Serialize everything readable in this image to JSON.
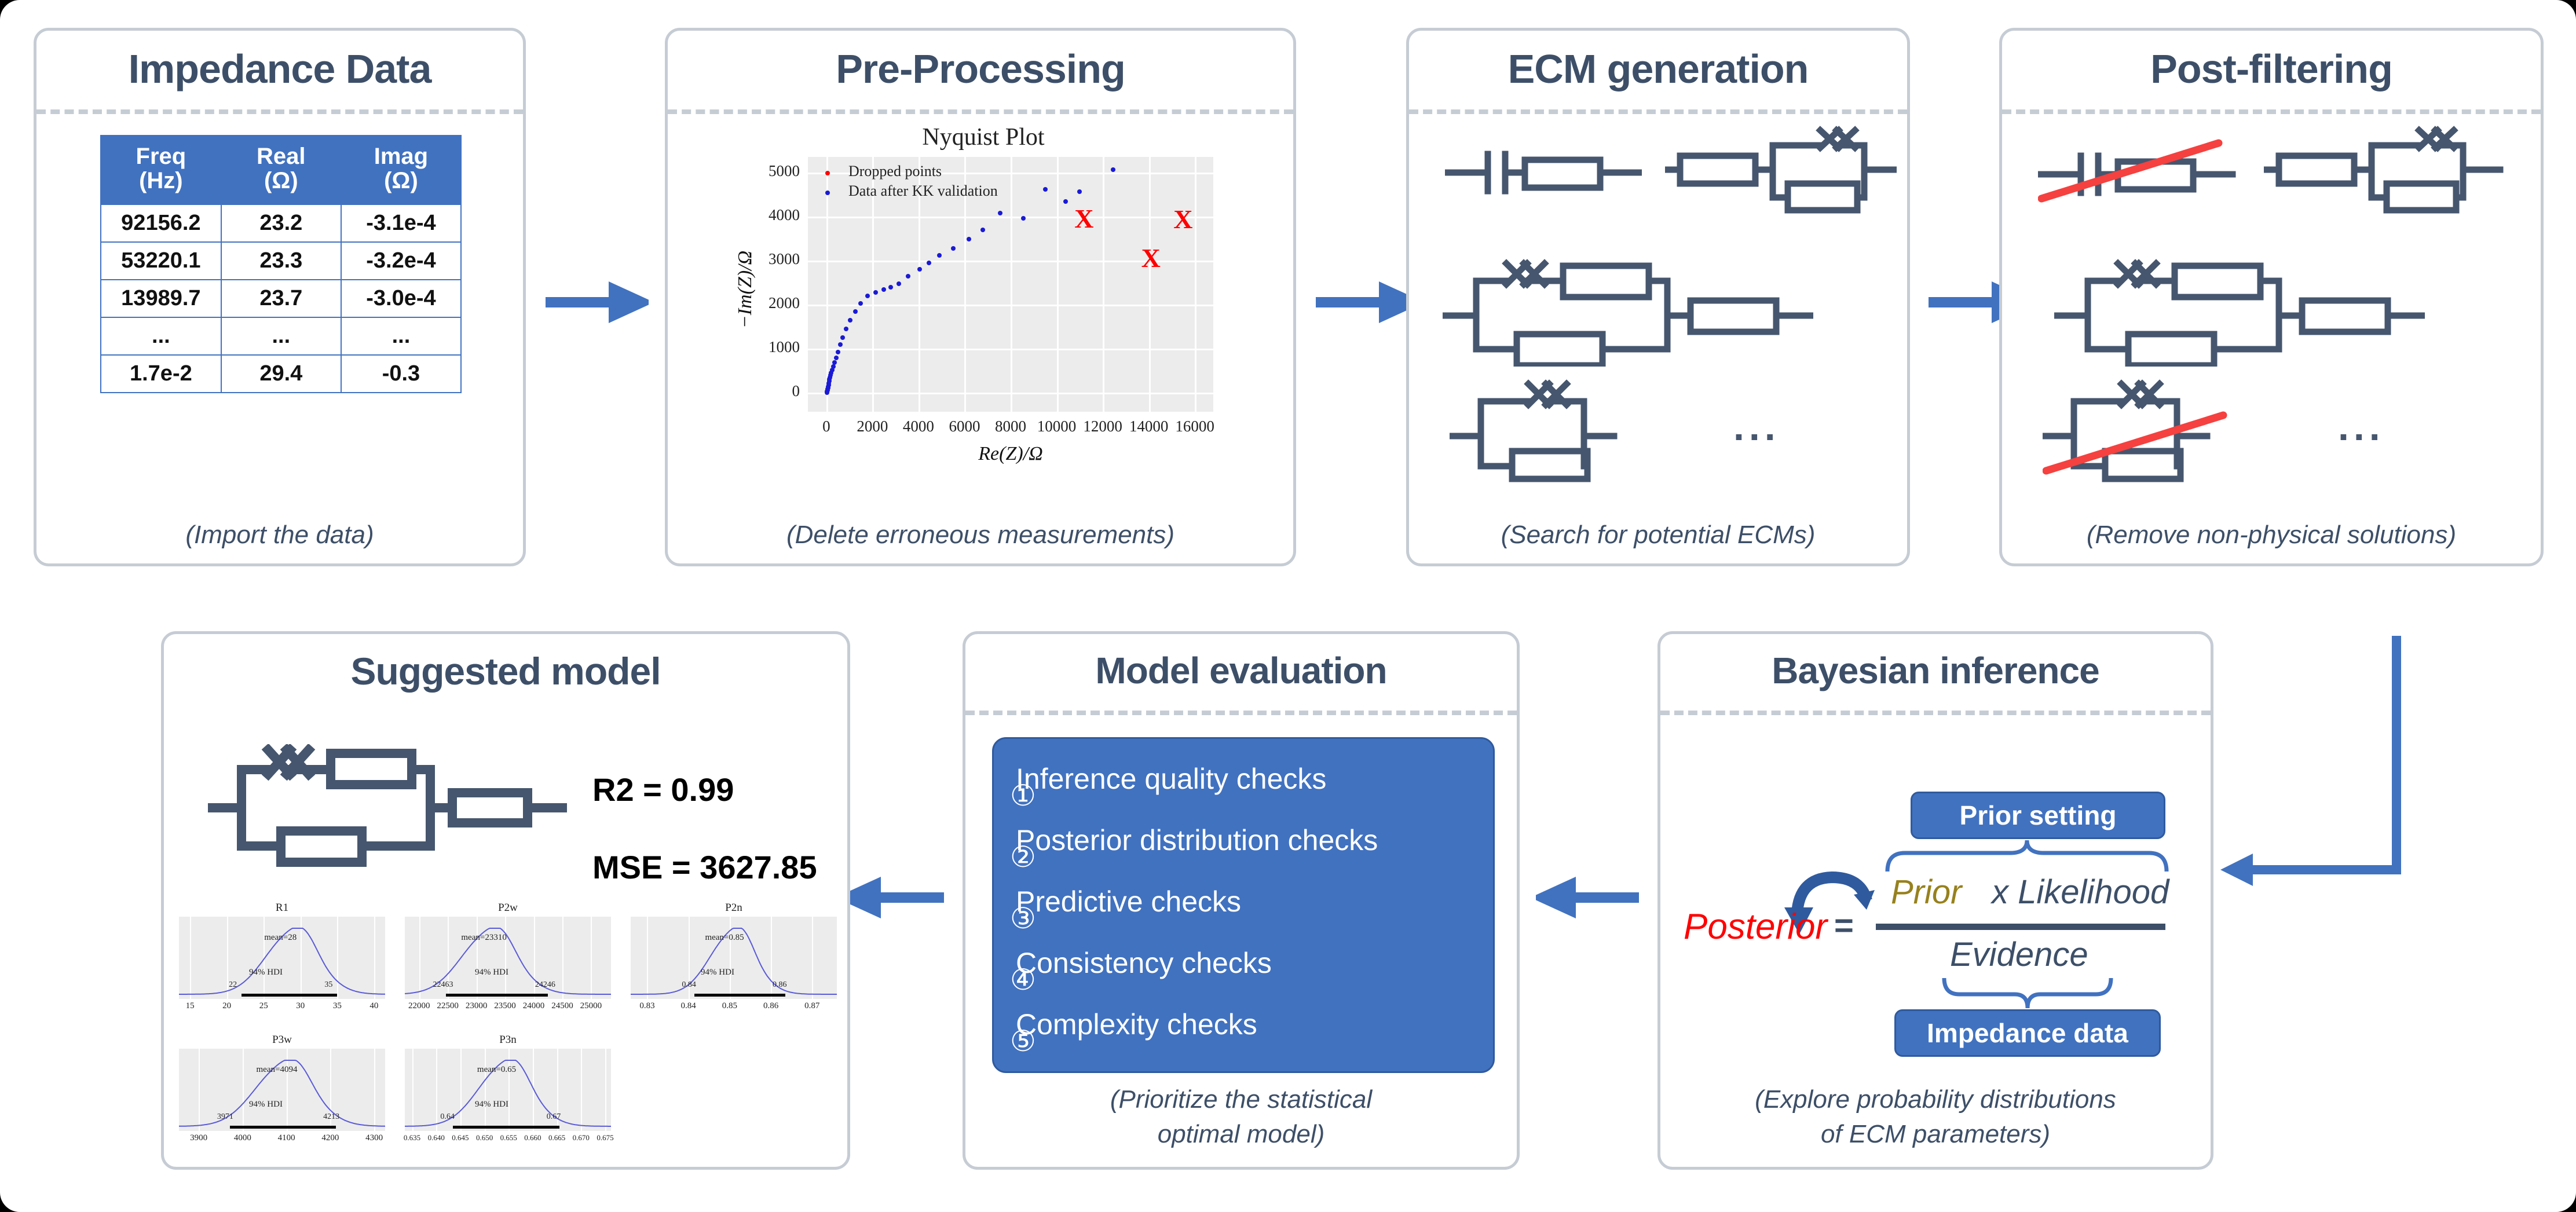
{
  "theme": {
    "accent": "#4172c0",
    "panel_border": "#c6ccd4",
    "title_color": "#3d4f68",
    "circuit_color": "#46566e",
    "strike_color": "#f5413f",
    "posterior_curve": "#5a5ad8",
    "dropped_marker": "#ff0000"
  },
  "panels": {
    "impedance": {
      "title": "Impedance Data",
      "caption": "(Import the data)",
      "table": {
        "headers": [
          "Freq\n(Hz)",
          "Real\n(Ω)",
          "Imag\n(Ω)"
        ],
        "header_lines": [
          [
            "Freq",
            "(Hz)"
          ],
          [
            "Real",
            "(Ω)"
          ],
          [
            "Imag",
            "(Ω)"
          ]
        ],
        "rows": [
          [
            "92156.2",
            "23.2",
            "-3.1e-4"
          ],
          [
            "53220.1",
            "23.3",
            "-3.2e-4"
          ],
          [
            "13989.7",
            "23.7",
            "-3.0e-4"
          ],
          [
            "...",
            "...",
            "..."
          ],
          [
            "1.7e-2",
            "29.4",
            "-0.3"
          ]
        ]
      }
    },
    "preprocessing": {
      "title": "Pre-Processing",
      "caption": "(Delete erroneous measurements)"
    },
    "ecm": {
      "title": "ECM generation",
      "caption": "(Search for potential ECMs)",
      "ellipsis": "..."
    },
    "postfilter": {
      "title": "Post-filtering",
      "caption": "(Remove non-physical solutions)",
      "ellipsis": "..."
    },
    "bayesian": {
      "title": "Bayesian inference",
      "caption_line1": "(Explore probability distributions",
      "caption_line2": "of ECM parameters)",
      "prior_badge": "Prior setting",
      "evidence_badge": "Impedance data",
      "posterior_label": "Posterior",
      "equals": "=",
      "numerator_prior": "Prior",
      "numerator_rest": "x Likelihood",
      "denominator": "Evidence"
    },
    "modeleval": {
      "title": "Model evaluation",
      "caption_line1": "(Prioritize the statistical",
      "caption_line2": "optimal model)",
      "checks": [
        {
          "num": "①",
          "label": "Inference quality checks"
        },
        {
          "num": "②",
          "label": "Posterior distribution checks"
        },
        {
          "num": "③",
          "label": "Predictive checks"
        },
        {
          "num": "④",
          "label": "Consistency checks"
        },
        {
          "num": "⑤",
          "label": "Complexity checks"
        }
      ]
    },
    "suggested": {
      "title": "Suggested model",
      "r2": "R2 = 0.99",
      "mse": "MSE = 3627.85"
    }
  },
  "chart_data": [
    {
      "id": "nyquist",
      "type": "scatter",
      "title": "Nyquist Plot",
      "xlabel": "Re(Z)/Ω",
      "ylabel": "−Im(Z)/Ω",
      "xlim": [
        -800,
        16800
      ],
      "ylim": [
        -430,
        5350
      ],
      "xticks": [
        0,
        2000,
        4000,
        6000,
        8000,
        10000,
        12000,
        14000,
        16000
      ],
      "yticks": [
        0,
        1000,
        2000,
        3000,
        4000,
        5000
      ],
      "grid": true,
      "legend_position": "upper-left",
      "series": [
        {
          "name": "Dropped points",
          "color": "#ff0000",
          "marker": "x",
          "points": [
            [
              11150,
              3960
            ],
            [
              15450,
              3950
            ],
            [
              14050,
              3060
            ]
          ]
        },
        {
          "name": "Data after KK validation",
          "color": "#1a1ad6",
          "marker": "o",
          "points": [
            [
              30,
              10
            ],
            [
              40,
              30
            ],
            [
              50,
              55
            ],
            [
              60,
              80
            ],
            [
              70,
              110
            ],
            [
              80,
              140
            ],
            [
              95,
              175
            ],
            [
              110,
              215
            ],
            [
              125,
              260
            ],
            [
              140,
              300
            ],
            [
              160,
              350
            ],
            [
              180,
              400
            ],
            [
              210,
              455
            ],
            [
              250,
              520
            ],
            [
              300,
              600
            ],
            [
              350,
              690
            ],
            [
              420,
              790
            ],
            [
              500,
              920
            ],
            [
              600,
              1090
            ],
            [
              720,
              1250
            ],
            [
              860,
              1450
            ],
            [
              1040,
              1650
            ],
            [
              1250,
              1840
            ],
            [
              1500,
              2030
            ],
            [
              1800,
              2200
            ],
            [
              2150,
              2280
            ],
            [
              2500,
              2340
            ],
            [
              2800,
              2400
            ],
            [
              3150,
              2470
            ],
            [
              3550,
              2640
            ],
            [
              4050,
              2800
            ],
            [
              4450,
              2950
            ],
            [
              4900,
              3120
            ],
            [
              5500,
              3280
            ],
            [
              6200,
              3490
            ],
            [
              6800,
              3690
            ],
            [
              7550,
              4070
            ],
            [
              8550,
              3960
            ],
            [
              9500,
              4620
            ],
            [
              10400,
              4340
            ],
            [
              11000,
              4560
            ],
            [
              12450,
              5060
            ]
          ]
        }
      ]
    },
    {
      "id": "R1",
      "type": "line",
      "title": "R1",
      "mean_label": "mean=28",
      "hdi_label": "94% HDI",
      "hdi_low": "22",
      "hdi_high": "35",
      "xticks": [
        "15",
        "20",
        "25",
        "30",
        "35",
        "40"
      ],
      "xlim": [
        13.5,
        41.5
      ],
      "hdi_range": [
        22,
        35
      ],
      "peak": 28.7,
      "sigma": 3.6
    },
    {
      "id": "P2w",
      "type": "line",
      "title": "P2w",
      "mean_label": "mean=23310",
      "hdi_label": "94% HDI",
      "hdi_low": "22463",
      "hdi_high": "24246",
      "xticks": [
        "22000",
        "22500",
        "23000",
        "23500",
        "24000",
        "24500",
        "25000"
      ],
      "xlim": [
        21750,
        25350
      ],
      "hdi_range": [
        22463,
        24246
      ],
      "peak": 23200,
      "sigma": 480
    },
    {
      "id": "P2n",
      "type": "line",
      "title": "P2n",
      "mean_label": "mean=0.85",
      "hdi_label": "94% HDI",
      "hdi_low": "0.84",
      "hdi_high": "0.86",
      "xticks": [
        "0.83",
        "0.84",
        "0.85",
        "0.86",
        "0.87"
      ],
      "xlim": [
        0.826,
        0.876
      ],
      "hdi_range": [
        0.8415,
        0.8635
      ],
      "peak": 0.8505,
      "sigma": 0.0055
    },
    {
      "id": "P3w",
      "type": "line",
      "title": "P3w",
      "mean_label": "mean=4094",
      "hdi_label": "94% HDI",
      "hdi_low": "3971",
      "hdi_high": "4213",
      "xticks": [
        "3900",
        "4000",
        "4100",
        "4200",
        "4300"
      ],
      "xlim": [
        3855,
        4325
      ],
      "hdi_range": [
        3971,
        4213
      ],
      "peak": 4092,
      "sigma": 66
    },
    {
      "id": "P3n",
      "type": "line",
      "title": "P3n",
      "mean_label": "mean=0.65",
      "hdi_label": "94% HDI",
      "hdi_low": "0.64",
      "hdi_high": "0.67",
      "xticks": [
        "0.635",
        "0.640",
        "0.645",
        "0.650",
        "0.655",
        "0.660",
        "0.665",
        "0.670",
        "0.675"
      ],
      "xlim": [
        0.6335,
        0.6762
      ],
      "hdi_range": [
        0.6435,
        0.6655
      ],
      "peak": 0.654,
      "sigma": 0.0055
    }
  ]
}
